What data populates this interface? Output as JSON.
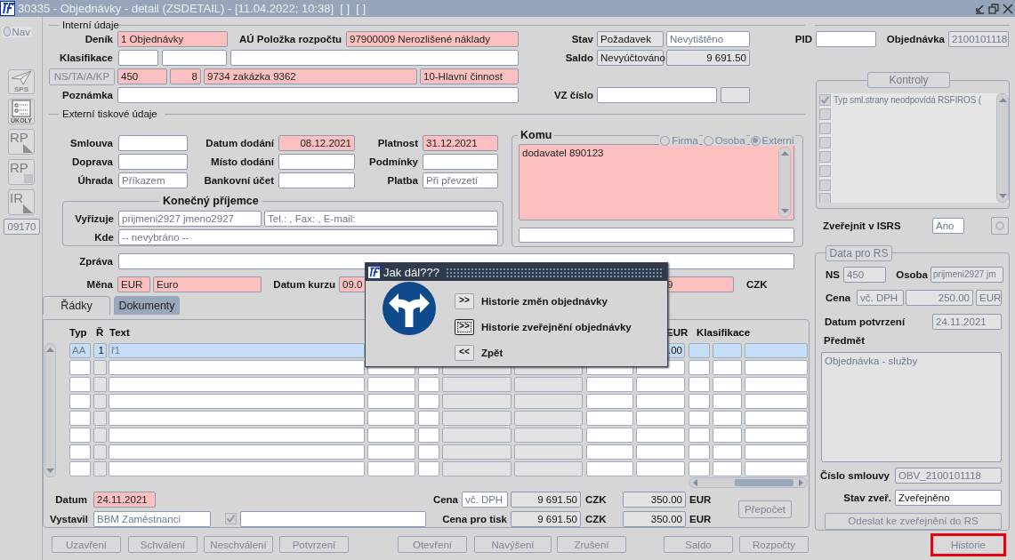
{
  "window": {
    "title": "30335 - Objednávky - detail (ZSDETAIL) - [11.04.2022; 10:38]  [ ]  [ ]"
  },
  "sidebar": {
    "nav": {
      "label": "Nav",
      "selected": false
    },
    "tools": [
      {
        "label": "SPS",
        "kind": "plane"
      },
      {
        "label": "ÚKOLY",
        "kind": "tasks"
      },
      {
        "label": "RP",
        "kind": "corner"
      },
      {
        "label": "RP",
        "kind": "dotted"
      },
      {
        "label": "IR",
        "kind": "corner"
      }
    ],
    "code": "09170"
  },
  "internal": {
    "legend": "Interní údaje",
    "denik": {
      "label": "Deník",
      "value": "1 Objednávky",
      "kind": "required"
    },
    "polozka": {
      "label": "AÚ Položka rozpočtu",
      "value": "97900009 Nerozlišené náklady",
      "kind": "required"
    },
    "stav": {
      "label": "Stav",
      "values": [
        {
          "value": "Požadavek",
          "kind": "display"
        },
        {
          "value": "Nevytištěno",
          "kind": "lookup"
        }
      ]
    },
    "pid": {
      "label": "PID"
    },
    "objednavka": {
      "label": "Objednávka",
      "value": "2100101118",
      "kind": "readonly"
    },
    "klasifikace": {
      "label": "Klasifikace"
    },
    "saldo": {
      "label": "Saldo",
      "values": [
        {
          "value": "Nevyúčtováno",
          "kind": "display"
        },
        {
          "value": "9 691.50",
          "kind": "display"
        }
      ]
    },
    "ns_button": "NS/TA/A/KP",
    "ns_values": [
      {
        "value": "450",
        "kind": "required"
      },
      {
        "value": "8",
        "kind": "required"
      },
      {
        "value": "9734 zakázka 9362",
        "kind": "required"
      },
      {
        "value": "10-Hlavní činnost",
        "kind": "required"
      }
    ],
    "poznamka": {
      "label": "Poznámka"
    },
    "vz": {
      "label": "VZ číslo"
    }
  },
  "external": {
    "legend": "Externí tiskové údaje",
    "smlouva": {
      "label": "Smlouva"
    },
    "datum_dodani": {
      "label": "Datum dodání",
      "value": "08.12.2021",
      "kind": "required"
    },
    "platnost": {
      "label": "Platnost",
      "value": "31.12.2021",
      "kind": "required"
    },
    "doprava": {
      "label": "Doprava"
    },
    "misto": {
      "label": "Místo dodání"
    },
    "podminky": {
      "label": "Podmínky"
    },
    "uhrada": {
      "label": "Úhrada",
      "value": "Příkazem",
      "kind": "lookup"
    },
    "bankovni": {
      "label": "Bankovní účet"
    },
    "platba": {
      "label": "Platba",
      "value": "Při převzetí",
      "kind": "lookup"
    },
    "prijemce": {
      "legend": "Konečný příjemce",
      "vyrizuje": {
        "label": "Vyřizuje",
        "values": [
          {
            "value": "prijmeni2927 jmeno2927",
            "kind": "lookup"
          },
          {
            "value": "Tel.: , Fax: , E-mail:",
            "kind": "lookup"
          }
        ]
      },
      "kde": {
        "label": "Kde",
        "value": "-- nevybráno --",
        "kind": "lookup"
      }
    },
    "komu": {
      "legend": "Komu",
      "options": [
        {
          "label": "Firma",
          "selected": false
        },
        {
          "label": "Osoba",
          "selected": false
        },
        {
          "label": "Externí",
          "selected": true
        }
      ],
      "text": "dodavatel 890123"
    },
    "zprava": {
      "label": "Zpráva"
    },
    "mena": {
      "label": "Měna",
      "values": [
        {
          "value": "EUR",
          "kind": "required"
        },
        {
          "value": "Euro",
          "kind": "required"
        }
      ]
    },
    "datum_kurzu": {
      "label": "Datum kurzu",
      "values": [
        {
          "value": "09.0",
          "kind": "required"
        },
        {
          "value": "9",
          "kind": "required"
        }
      ]
    },
    "currency": "CZK"
  },
  "tabs": [
    {
      "label": "Řádky",
      "selected": true
    },
    {
      "label": "Dokumenty",
      "selected": false
    }
  ],
  "table": {
    "columns": [
      "Typ",
      "Ř",
      "Text",
      "EUR",
      "Klasifikace"
    ],
    "rows": [
      {
        "cells": [
          "AA",
          "1",
          "ř1",
          ".00"
        ],
        "selected": true
      },
      {
        "selected": false
      },
      {
        "selected": false
      },
      {
        "selected": false
      },
      {
        "selected": false
      },
      {
        "selected": false
      },
      {
        "selected": false
      },
      {
        "selected": false
      }
    ]
  },
  "totals": {
    "datum": {
      "label": "Datum",
      "value": "24.11.2021",
      "kind": "required"
    },
    "vystavil": {
      "label": "Vystavil",
      "value": "BBM Zaměstnanci",
      "kind": "lookup",
      "checked": true
    },
    "cena": {
      "label": "Cena",
      "values": [
        {
          "value": "vč. DPH",
          "kind": "lookup"
        },
        {
          "value": "9 691.50",
          "kind": "display"
        },
        {
          "value": "350.00",
          "kind": "display"
        }
      ],
      "units": [
        "CZK",
        "EUR"
      ]
    },
    "cena_tisk": {
      "label": "Cena pro tisk",
      "values": [
        {
          "value": "9 691.50",
          "kind": "display"
        },
        {
          "value": "350.00",
          "kind": "display"
        }
      ],
      "units": [
        "CZK",
        "EUR"
      ]
    },
    "prepocet": "Přepočet"
  },
  "actions": [
    {
      "label": "Uzavření",
      "highlighted": false
    },
    {
      "label": "Schválení",
      "highlighted": false
    },
    {
      "label": "Neschválení",
      "highlighted": false
    },
    {
      "label": "Potvrzení",
      "highlighted": false
    },
    {
      "label": "Otevření",
      "highlighted": false
    },
    {
      "label": "Navýšení",
      "highlighted": false
    },
    {
      "label": "Zrušení",
      "highlighted": false
    },
    {
      "label": "Saldo",
      "highlighted": false
    },
    {
      "label": "Rozpočty",
      "highlighted": false
    },
    {
      "label": "Historie",
      "highlighted": true
    }
  ],
  "kontroly": {
    "title": "Kontroly",
    "items": [
      {
        "text": "Typ sml.strany neodpovídá RSFIROS (",
        "checked": true
      },
      {
        "checked": false
      },
      {
        "checked": false
      },
      {
        "checked": false
      },
      {
        "checked": false
      },
      {
        "checked": false
      },
      {
        "checked": false
      },
      {
        "checked": false
      }
    ]
  },
  "zverejnit": {
    "label": "Zveřejnit v ISRS",
    "value": "Ano",
    "kind": "lookup"
  },
  "rs": {
    "title": "Data pro RS",
    "ns": {
      "label": "NS",
      "value": "450",
      "kind": "readonly"
    },
    "osoba": {
      "label": "Osoba",
      "value": "prijmeni2927 jm",
      "kind": "readonly"
    },
    "cena": {
      "label": "Cena",
      "values": [
        {
          "value": "vč. DPH",
          "kind": "readonly"
        },
        {
          "value": "250.00",
          "kind": "readonly"
        },
        {
          "value": "EUR",
          "kind": "readonly"
        }
      ]
    },
    "datum_potvrzeni": {
      "label": "Datum potvrzení",
      "value": "24.11.2021",
      "kind": "readonly"
    },
    "predmet": {
      "label": "Předmět",
      "value": "Objednávka - služby",
      "kind": "readonly"
    },
    "cislo_smlouvy": {
      "label": "Číslo smlouvy",
      "value": "OBV_2100101118",
      "kind": "readonly"
    },
    "stav_zver": {
      "label": "Stav zveř.",
      "value": "Zveřejněno",
      "kind": "input"
    },
    "send": "Odeslat ke zveřejnění do RS"
  },
  "dialog": {
    "title": "Jak dál???",
    "options": [
      {
        "key": ">>",
        "label": "Historie změn objednávky",
        "focused": false
      },
      {
        "key": ">>",
        "label": "Historie zveřejnění objednávky",
        "focused": true
      },
      {
        "key": "<<",
        "label": "Zpět",
        "focused": false
      }
    ]
  }
}
